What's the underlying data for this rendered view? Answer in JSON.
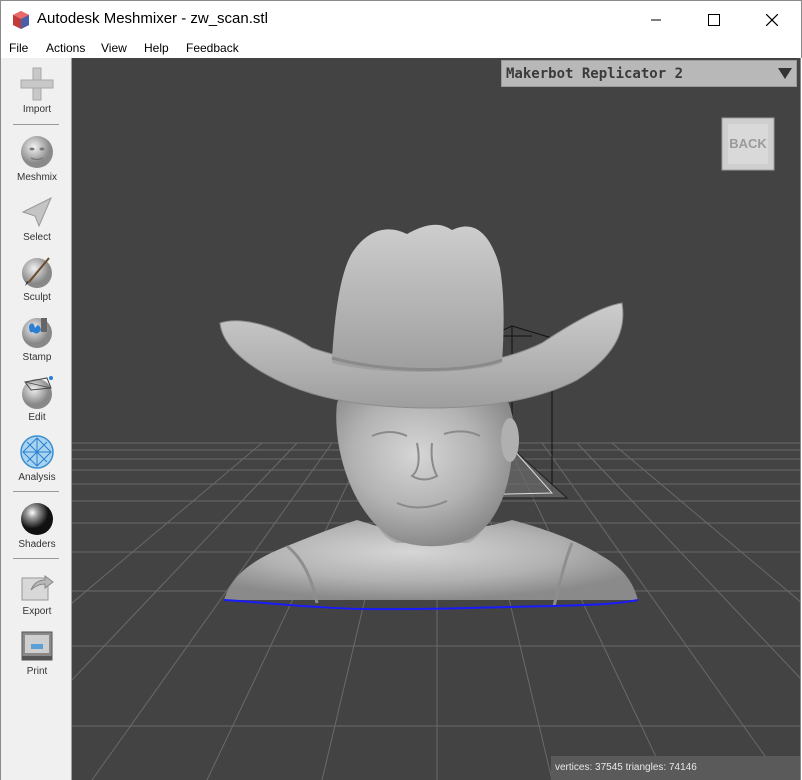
{
  "window": {
    "title": "Autodesk Meshmixer - zw_scan.stl"
  },
  "menu": {
    "items": [
      "File",
      "Actions",
      "View",
      "Help",
      "Feedback"
    ]
  },
  "toolbar": {
    "tools": [
      {
        "label": "Import",
        "icon": "plus-icon"
      },
      {
        "label": "Meshmix",
        "icon": "meshmix-face-icon"
      },
      {
        "label": "Select",
        "icon": "select-arrow-icon"
      },
      {
        "label": "Sculpt",
        "icon": "sculpt-brush-icon"
      },
      {
        "label": "Stamp",
        "icon": "stamp-icon"
      },
      {
        "label": "Edit",
        "icon": "edit-sphere-icon"
      },
      {
        "label": "Analysis",
        "icon": "analysis-mesh-icon"
      },
      {
        "label": "Shaders",
        "icon": "shader-sphere-icon"
      },
      {
        "label": "Export",
        "icon": "export-icon"
      },
      {
        "label": "Print",
        "icon": "printer-icon"
      }
    ]
  },
  "viewport": {
    "printer": "Makerbot Replicator 2",
    "view_cube_label": "BACK",
    "stats": "vertices: 37545 triangles: 74146"
  },
  "colors": {
    "viewport_bg": "#434343",
    "mesh": "#b4b4b4",
    "boundary": "#1a1aff"
  }
}
